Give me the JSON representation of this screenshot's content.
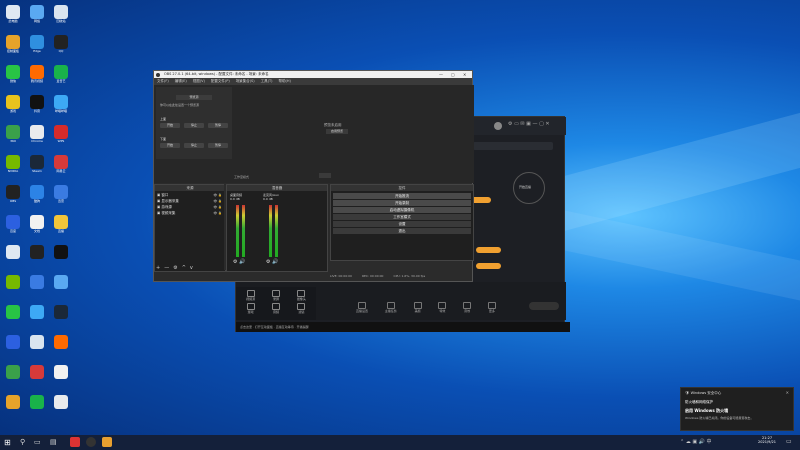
{
  "obs": {
    "title": "OBS 27.0.1 (64-bit, windows) - 配置文件: 未命名 - 场景: 未命名",
    "menu": [
      "文件(F)",
      "编辑(E)",
      "视图(V)",
      "配置文件(P)",
      "场景集合(S)",
      "工具(T)",
      "帮助(H)"
    ],
    "notice": "你可以在此处设置一个预览源",
    "notice_btn": "预览源",
    "preview_text": "预览未启用",
    "preview_sub": "启用预览",
    "studio_label": "工作室模式",
    "scenes_label": "场景",
    "sources_label": "来源",
    "sources": [
      "窗口",
      "显示器采集",
      "游戏源",
      "视频采集"
    ],
    "mixer_label": "混音器",
    "mixer_tracks": [
      "桌面音频",
      "麦克风/Aux"
    ],
    "mixer_levels": [
      "0.0 dB",
      "0.0 dB"
    ],
    "controls_label": "控件",
    "controls": [
      "开始推流",
      "开始录制",
      "启动虚拟摄像机",
      "工作室模式",
      "设置",
      "退出"
    ],
    "status": [
      "LIVE: 00:00:00",
      "REC: 00:00:00",
      "CPU: 1.6%, 30.00 fps"
    ],
    "list_buttons": [
      "+",
      "—",
      "⚙",
      "^",
      "v"
    ],
    "left_group_a": "上面",
    "left_group_b": "下面",
    "left_btns": [
      "开始",
      "停止",
      "暂停"
    ]
  },
  "live": {
    "title": "直播伴侣",
    "tools": [
      "视频源",
      "录屏",
      "摄像头",
      "游戏",
      "音频",
      "滤镜"
    ],
    "bottom_tools": [
      "直播设置",
      "主播任务",
      "美颜",
      "特效",
      "音效",
      "更多"
    ],
    "start_btn": "开始直播",
    "status_line": "点击这里 · 打开互动面板 · 直播互动等待 · 开播提醒"
  },
  "toast": {
    "app": "Windows 安全中心",
    "title": "防火墙和网络保护",
    "subtitle": "启用 Windows 防火墙",
    "body": "Windows 防火墙已关闭。你的设备可能易受攻击。"
  },
  "taskbar": {
    "clock": "21:27",
    "date": "2021/9/21"
  },
  "desktop_icons": [
    {
      "label": "此电脑",
      "color": "#dfe8f2"
    },
    {
      "label": "网络",
      "color": "#5aa9f2"
    },
    {
      "label": "回收站",
      "color": "#d9e4ef"
    },
    {
      "label": "控制面板",
      "color": "#e6a32a"
    },
    {
      "label": "Edge",
      "color": "#2f8fe0"
    },
    {
      "label": "QQ",
      "color": "#222"
    },
    {
      "label": "微信",
      "color": "#28c445"
    },
    {
      "label": "腾讯视频",
      "color": "#ff6a00"
    },
    {
      "label": "爱奇艺",
      "color": "#19b34a"
    },
    {
      "label": "游戏",
      "color": "#e8c31d"
    },
    {
      "label": "抖音",
      "color": "#111"
    },
    {
      "label": "哔哩哔哩",
      "color": "#3da9f5"
    },
    {
      "label": "360",
      "color": "#3aa14a"
    },
    {
      "label": "Chrome",
      "color": "#e8eaed"
    },
    {
      "label": "WPS",
      "color": "#d52b2b"
    },
    {
      "label": "NVIDIA",
      "color": "#76b900"
    },
    {
      "label": "Steam",
      "color": "#1b2838"
    },
    {
      "label": "网易云",
      "color": "#d63a3a"
    },
    {
      "label": "OBS",
      "color": "#222"
    },
    {
      "label": "酷狗",
      "color": "#2c83e6"
    },
    {
      "label": "迅雷",
      "color": "#3a7be2"
    },
    {
      "label": "百度",
      "color": "#2c60e0"
    },
    {
      "label": "文档",
      "color": "#f1f1f1"
    },
    {
      "label": "直播",
      "color": "#f2c53a"
    }
  ]
}
